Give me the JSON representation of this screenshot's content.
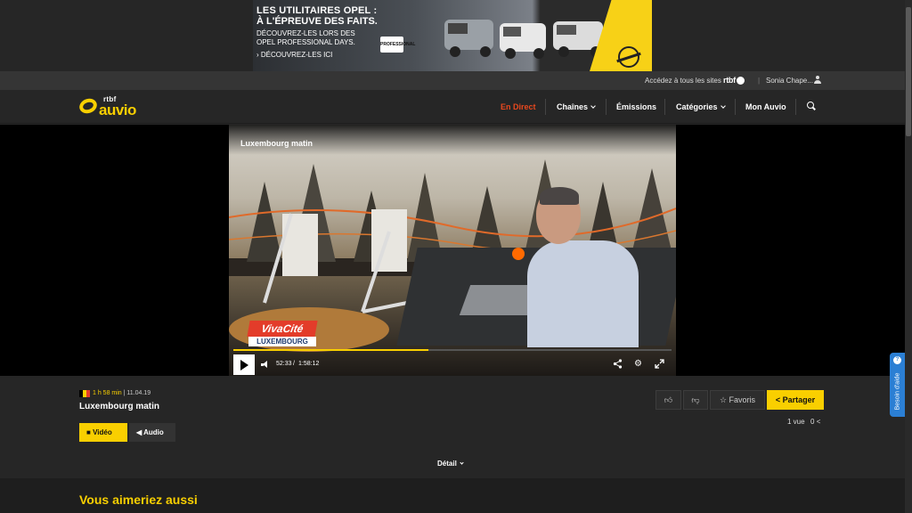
{
  "ad": {
    "headline1": "LES UTILITAIRES OPEL :",
    "headline2": "À L'ÉPREUVE DES FAITS.",
    "sub1": "DÉCOUVREZ-LES LORS DES",
    "sub2": "OPEL PROFESSIONAL DAYS.",
    "cta": "› DÉCOUVREZ-LES ICI",
    "badge": "PROFESSIONAL",
    "brand_color": "#f7d117"
  },
  "utility": {
    "access_text": "Accédez à tous les sites",
    "rtbf_label": "rtbf",
    "separator": "|",
    "user_name": "Sonia Chape..."
  },
  "header": {
    "logo_small": "rtbf",
    "logo_big": "auvio",
    "nav": [
      {
        "label": "En Direct"
      },
      {
        "label": "Chaînes"
      },
      {
        "label": "Émissions"
      },
      {
        "label": "Catégories"
      },
      {
        "label": "Mon Auvio"
      }
    ],
    "accent_color": "#e8481e"
  },
  "player": {
    "overlay_title": "Luxembourg matin",
    "channel_logo_top": "VivaCité",
    "channel_logo_bottom": "LUXEMBOURG",
    "current_time": "52:33",
    "time_sep": "/",
    "duration": "1:58:12",
    "progress": 0.445,
    "progress_color": "#f9cf00"
  },
  "info": {
    "duration_label": "1 h 58 min",
    "meta_sep": "|",
    "date": "11.04.19",
    "title": "Luxembourg matin",
    "tabs": [
      {
        "label": "Vidéo"
      },
      {
        "label": "Audio"
      }
    ],
    "favoris": "Favoris",
    "partager": "Partager",
    "views": "1 vue",
    "shares": "0",
    "detail": "Détail"
  },
  "bottom": {
    "title": "Vous aimeriez aussi"
  },
  "help": {
    "label": "Besoin d'aide"
  }
}
